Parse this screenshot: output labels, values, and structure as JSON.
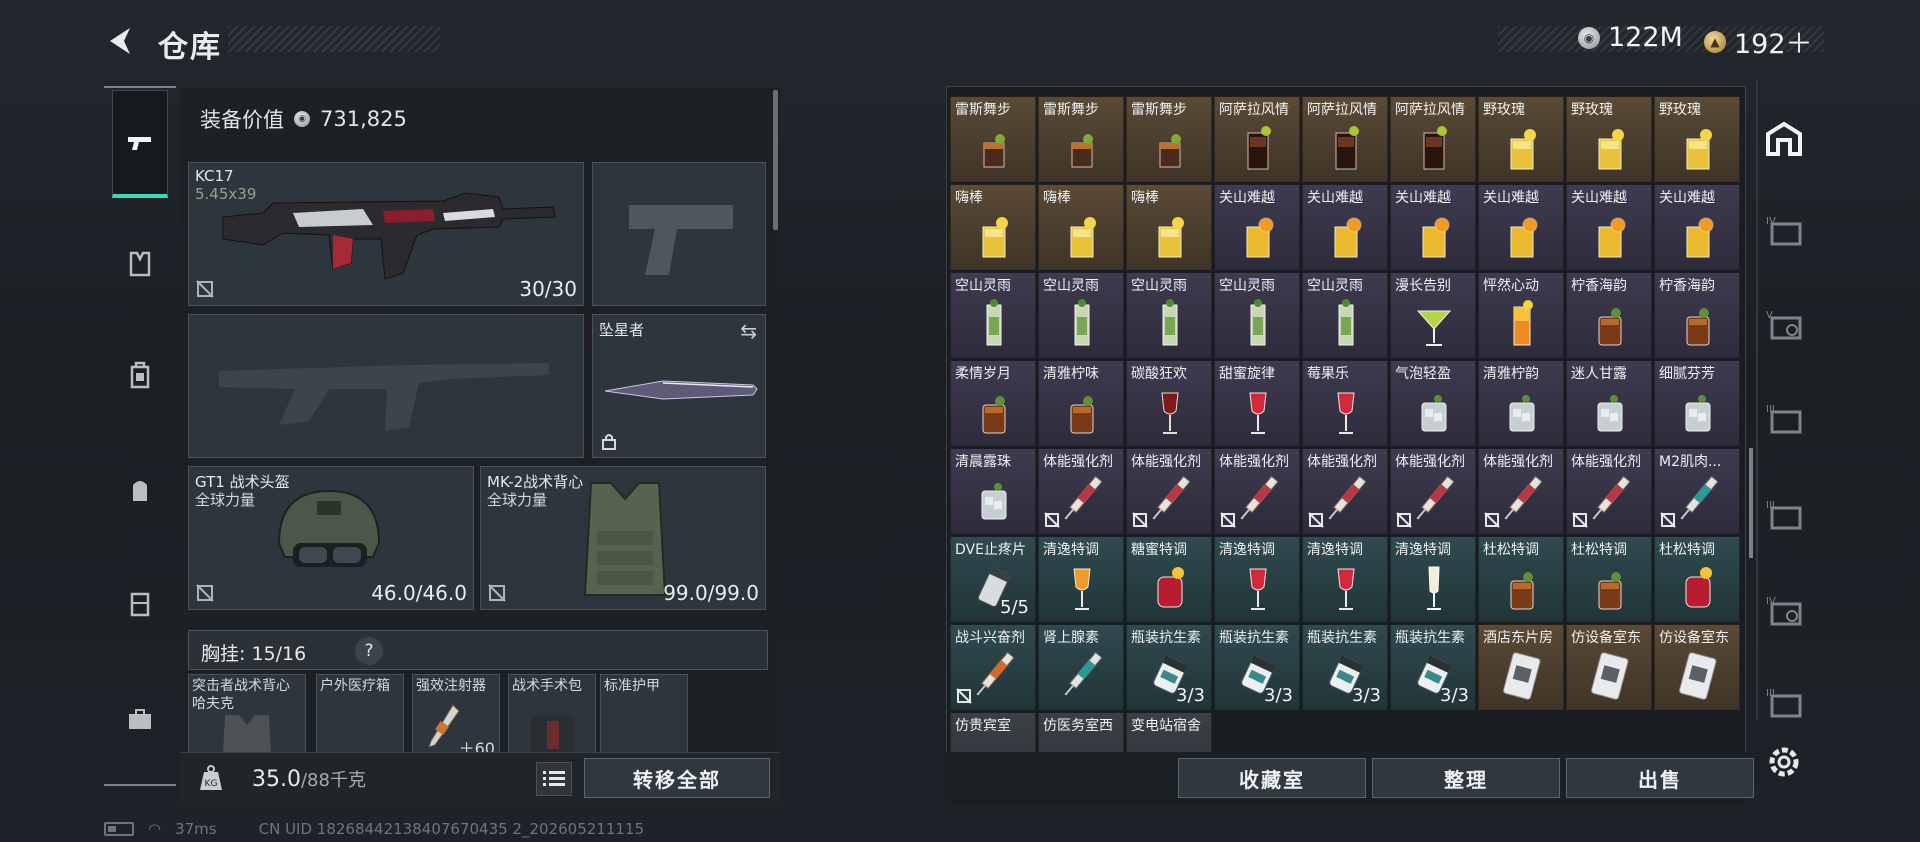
{
  "header": {
    "title": "仓库",
    "currency_silver": "122M",
    "currency_gold": "192＋"
  },
  "loadout": {
    "equip_value_label": "装备价值",
    "equip_value": "731,825",
    "primary": {
      "name": "KC17",
      "caliber": "5.45x39",
      "ammo": "30/30"
    },
    "melee": {
      "name": "坠星者"
    },
    "helmet": {
      "name": "GT1 战术头盔",
      "faction": "全球力量",
      "durability": "46.0/46.0"
    },
    "armor": {
      "name": "MK-2战术背心",
      "faction": "全球力量",
      "durability": "99.0/99.0"
    },
    "chest_rig": {
      "label": "胸挂:",
      "capacity": "15/16",
      "help": "?"
    },
    "chest_items": [
      {
        "name": "突击者战术背心\n哈夫克"
      },
      {
        "name": "户外医疗箱"
      },
      {
        "name": "强效注射器",
        "count": "＋60"
      },
      {
        "name": "战术手术包"
      },
      {
        "name": "标准护甲"
      }
    ],
    "weight": "35.0",
    "weight_cap": "/88千克",
    "transfer_all": "转移全部"
  },
  "storage": {
    "rows": [
      [
        {
          "name": "雷斯舞步",
          "tone": "gold",
          "art": "cocktail-brown"
        },
        {
          "name": "雷斯舞步",
          "tone": "gold",
          "art": "cocktail-brown"
        },
        {
          "name": "雷斯舞步",
          "tone": "gold",
          "art": "cocktail-brown"
        },
        {
          "name": "阿萨拉风情",
          "tone": "gold",
          "art": "cola-glass"
        },
        {
          "name": "阿萨拉风情",
          "tone": "gold",
          "art": "cola-glass"
        },
        {
          "name": "阿萨拉风情",
          "tone": "gold",
          "art": "cola-glass"
        },
        {
          "name": "野玫瑰",
          "tone": "gold",
          "art": "lemon-drink"
        },
        {
          "name": "野玫瑰",
          "tone": "gold",
          "art": "lemon-drink"
        },
        {
          "name": "野玫瑰",
          "tone": "gold",
          "art": "lemon-drink"
        }
      ],
      [
        {
          "name": "嗨棒",
          "tone": "gold",
          "art": "lemon-drink"
        },
        {
          "name": "嗨棒",
          "tone": "gold",
          "art": "lemon-drink"
        },
        {
          "name": "嗨棒",
          "tone": "gold",
          "art": "lemon-drink"
        },
        {
          "name": "关山难越",
          "tone": "purple",
          "art": "orange-drink"
        },
        {
          "name": "关山难越",
          "tone": "purple",
          "art": "orange-drink"
        },
        {
          "name": "关山难越",
          "tone": "purple",
          "art": "orange-drink"
        },
        {
          "name": "关山难越",
          "tone": "purple",
          "art": "orange-drink"
        },
        {
          "name": "关山难越",
          "tone": "purple",
          "art": "orange-drink"
        },
        {
          "name": "关山难越",
          "tone": "purple",
          "art": "orange-drink"
        }
      ],
      [
        {
          "name": "空山灵雨",
          "tone": "purple",
          "art": "mint-tall"
        },
        {
          "name": "空山灵雨",
          "tone": "purple",
          "art": "mint-tall"
        },
        {
          "name": "空山灵雨",
          "tone": "purple",
          "art": "mint-tall"
        },
        {
          "name": "空山灵雨",
          "tone": "purple",
          "art": "mint-tall"
        },
        {
          "name": "空山灵雨",
          "tone": "purple",
          "art": "mint-tall"
        },
        {
          "name": "漫长告别",
          "tone": "purple",
          "art": "martini"
        },
        {
          "name": "怦然心动",
          "tone": "purple",
          "art": "sunrise"
        },
        {
          "name": "柠香海韵",
          "tone": "purple",
          "art": "tea-glass"
        },
        {
          "name": "柠香海韵",
          "tone": "purple",
          "art": "tea-glass"
        }
      ],
      [
        {
          "name": "柔情岁月",
          "tone": "purple",
          "art": "tea-glass"
        },
        {
          "name": "清雅柠味",
          "tone": "purple",
          "art": "tea-glass"
        },
        {
          "name": "碳酸狂欢",
          "tone": "purple",
          "art": "wine-dark"
        },
        {
          "name": "甜蜜旋律",
          "tone": "purple",
          "art": "wine-red"
        },
        {
          "name": "莓果乐",
          "tone": "purple",
          "art": "wine-red"
        },
        {
          "name": "气泡轻盈",
          "tone": "purple",
          "art": "ice-glass"
        },
        {
          "name": "清雅柠韵",
          "tone": "purple",
          "art": "ice-glass"
        },
        {
          "name": "迷人甘露",
          "tone": "purple",
          "art": "ice-glass"
        },
        {
          "name": "细腻芬芳",
          "tone": "purple",
          "art": "ice-glass"
        }
      ],
      [
        {
          "name": "清晨露珠",
          "tone": "purple",
          "art": "ice-glass"
        },
        {
          "name": "体能强化剂",
          "tone": "purple",
          "art": "syringe-red",
          "locked": true
        },
        {
          "name": "体能强化剂",
          "tone": "purple",
          "art": "syringe-red",
          "locked": true
        },
        {
          "name": "体能强化剂",
          "tone": "purple",
          "art": "syringe-red",
          "locked": true
        },
        {
          "name": "体能强化剂",
          "tone": "purple",
          "art": "syringe-red",
          "locked": true
        },
        {
          "name": "体能强化剂",
          "tone": "purple",
          "art": "syringe-red",
          "locked": true
        },
        {
          "name": "体能强化剂",
          "tone": "purple",
          "art": "syringe-red",
          "locked": true
        },
        {
          "name": "体能强化剂",
          "tone": "purple",
          "art": "syringe-red",
          "locked": true
        },
        {
          "name": "M2肌肉...",
          "tone": "purple",
          "art": "syringe-teal",
          "locked": true
        }
      ],
      [
        {
          "name": "DVE止疼片",
          "tone": "teal",
          "art": "pill-bottle",
          "count": "5/5"
        },
        {
          "name": "清逸特调",
          "tone": "teal",
          "art": "wine-orange"
        },
        {
          "name": "糖蜜特调",
          "tone": "teal",
          "art": "glass-red"
        },
        {
          "name": "清逸特调",
          "tone": "teal",
          "art": "wine-red"
        },
        {
          "name": "清逸特调",
          "tone": "teal",
          "art": "wine-red"
        },
        {
          "name": "清逸特调",
          "tone": "teal",
          "art": "flute"
        },
        {
          "name": "杜松特调",
          "tone": "teal",
          "art": "tea-glass"
        },
        {
          "name": "杜松特调",
          "tone": "teal",
          "art": "tea-glass"
        },
        {
          "name": "杜松特调",
          "tone": "teal",
          "art": "glass-red"
        }
      ],
      [
        {
          "name": "战斗兴奋剂",
          "tone": "teal",
          "art": "syringe-orange",
          "locked": true
        },
        {
          "name": "肾上腺素",
          "tone": "teal",
          "art": "syringe-teal"
        },
        {
          "name": "瓶装抗生素",
          "tone": "teal",
          "art": "pill-can",
          "count": "3/3"
        },
        {
          "name": "瓶装抗生素",
          "tone": "teal",
          "art": "pill-can",
          "count": "3/3"
        },
        {
          "name": "瓶装抗生素",
          "tone": "teal",
          "art": "pill-can",
          "count": "3/3"
        },
        {
          "name": "瓶装抗生素",
          "tone": "teal",
          "art": "pill-can",
          "count": "3/3"
        },
        {
          "name": "酒店东片房",
          "tone": "gold",
          "art": "keycard"
        },
        {
          "name": "仿设备室东",
          "tone": "gold",
          "art": "keycard"
        },
        {
          "name": "仿设备室东",
          "tone": "gold",
          "art": "keycard"
        }
      ],
      [
        {
          "name": "仿贵宾室",
          "tone": "dark",
          "art": "none"
        },
        {
          "name": "仿医务室西",
          "tone": "dark",
          "art": "none"
        },
        {
          "name": "变电站宿舍",
          "tone": "dark",
          "art": "none"
        }
      ]
    ],
    "buttons": {
      "collection": "收藏室",
      "sort": "整理",
      "sell": "出售"
    }
  },
  "status_bar": {
    "ping": "37ms",
    "uid": "CN UID 18268442138407670435 2_202605211115"
  }
}
